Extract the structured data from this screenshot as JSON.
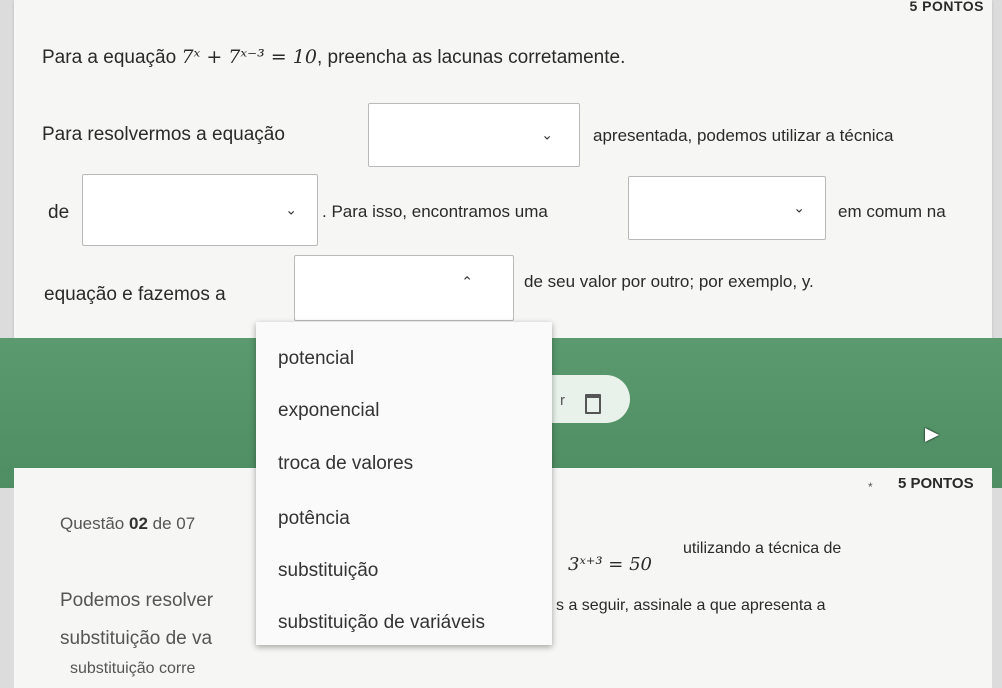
{
  "question1": {
    "points": "5 PONTOS",
    "prompt_prefix": "Para a equação ",
    "equation": "7ˣ + 7ˣ⁻³ = 10",
    "prompt_suffix": ", preencha as lacunas corretamente.",
    "line1_before": "Para resolvermos a equação",
    "line1_after": "apresentada, podemos utilizar a técnica",
    "line2_before": "de",
    "line2_middle": ". Para isso, encontramos uma",
    "line2_after": "em comum na",
    "line3_before": "equação e fazemos a",
    "line3_after": "de seu valor por outro; por exemplo, y.",
    "selects": [
      {
        "value": "",
        "chevron": "chevron-down"
      },
      {
        "value": "",
        "chevron": "chevron-down"
      },
      {
        "value": "",
        "chevron": "chevron-down"
      },
      {
        "value": "",
        "chevron": "chevron-up"
      }
    ]
  },
  "dropdown": {
    "options": [
      "potencial",
      "exponencial",
      "troca de valores",
      "potência",
      "substituição",
      "substituição de variáveis"
    ]
  },
  "question2": {
    "points": "5 PONTOS",
    "label_prefix": "Questão ",
    "number": "02",
    "label_suffix": " de 07",
    "text_line1_a": "Podemos resolver",
    "equation": "3ˣ⁺³ = 50",
    "text_line1_b": "utilizando a técnica de",
    "text_line2_a": "substituição de va",
    "text_line2_b": "s a seguir, assinale a que apresenta a",
    "text_line3": "substituição corre"
  },
  "colors": {
    "accent_green": "#5a9a6e",
    "card_bg": "#f6f6f4"
  }
}
